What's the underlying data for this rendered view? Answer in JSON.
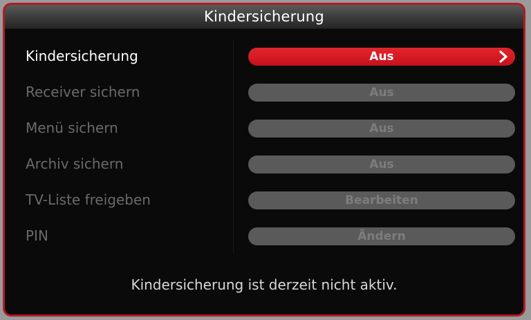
{
  "dialog": {
    "title": "Kindersicherung"
  },
  "rows": [
    {
      "label": "Kindersicherung",
      "value": "Aus"
    },
    {
      "label": "Receiver sichern",
      "value": "Aus"
    },
    {
      "label": "Menü sichern",
      "value": "Aus"
    },
    {
      "label": "Archiv sichern",
      "value": "Aus"
    },
    {
      "label": "TV-Liste freigeben",
      "value": "Bearbeiten"
    },
    {
      "label": "PIN",
      "value": "Ändern"
    }
  ],
  "status": {
    "text": "Kindersicherung ist derzeit nicht aktiv."
  },
  "colors": {
    "accent": "#d81b23",
    "border": "#b51a22",
    "disabled_pill": "#5a5a5a",
    "disabled_text": "#6a6a6a"
  },
  "icons": {
    "selector": "chevron-right-icon"
  }
}
